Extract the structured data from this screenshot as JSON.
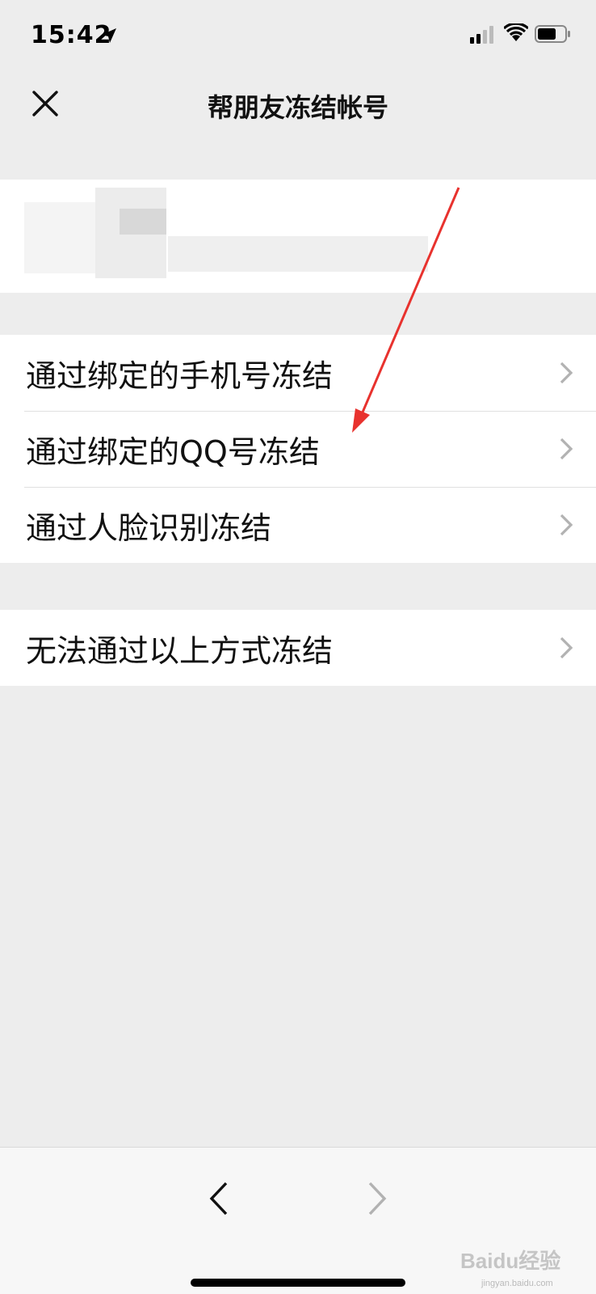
{
  "status_bar": {
    "time": "15:42",
    "icons": [
      "location-arrow-icon",
      "signal-icon",
      "wifi-icon",
      "battery-icon"
    ]
  },
  "nav": {
    "title": "帮朋友冻结帐号",
    "close_icon": "close-icon"
  },
  "menu": {
    "group1": [
      {
        "label": "通过绑定的手机号冻结"
      },
      {
        "label": "通过绑定的QQ号冻结"
      },
      {
        "label": "通过人脸识别冻结"
      }
    ],
    "group2": [
      {
        "label": "无法通过以上方式冻结"
      }
    ]
  },
  "toolbar": {
    "back_icon": "chevron-left-icon",
    "forward_icon": "chevron-right-icon"
  },
  "watermark": {
    "text": "Baidu经验",
    "sub": "jingyan.baidu.com"
  },
  "colors": {
    "background": "#ededed",
    "card": "#ffffff",
    "annotation": "#e8322e"
  }
}
